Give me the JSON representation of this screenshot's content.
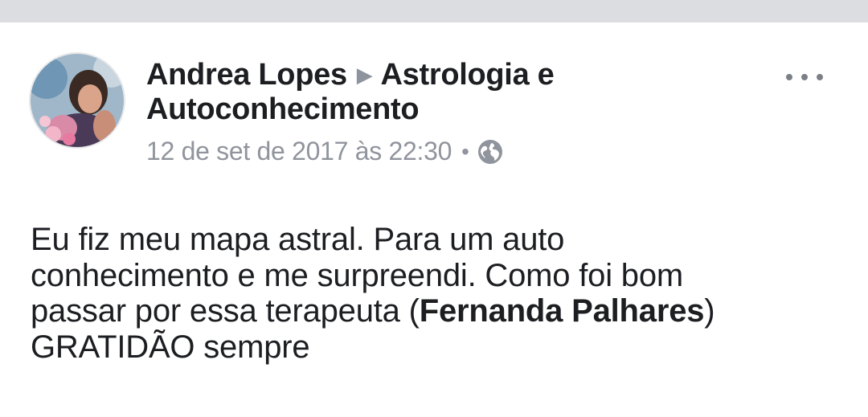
{
  "post": {
    "author": "Andrea Lopes",
    "group": "Astrologia e Autoconhecimento",
    "group_line1": "Astrologia e",
    "group_line2": "Autoconhecimento",
    "timestamp": "12 de set de 2017 às 22:30",
    "separator": "•",
    "privacy_icon": "globe-icon",
    "more_icon": "more-options-icon",
    "body": {
      "line1": "Eu fiz meu mapa astral. Para um auto",
      "line2": "conhecimento e me surpreendi. Como foi bom",
      "line3_pre": "passar por essa terapeuta (",
      "line3_bold": "Fernanda Palhares",
      "line3_post": ")",
      "line4": "GRATIDÃO  sempre"
    }
  },
  "colors": {
    "text": "#1c1e21",
    "meta": "#90949c",
    "top_strip": "#dcdde0"
  }
}
